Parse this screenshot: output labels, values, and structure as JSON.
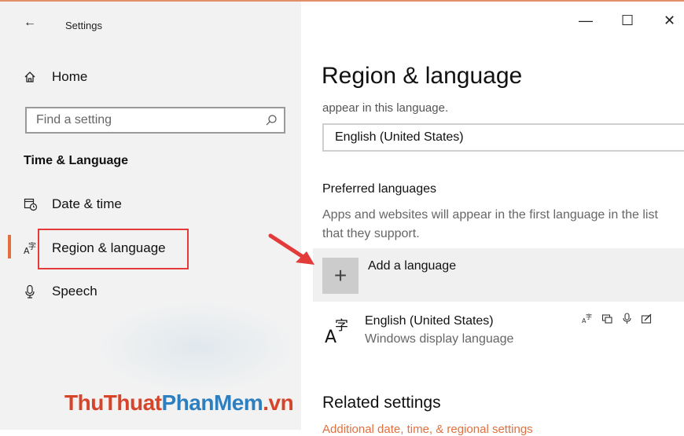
{
  "window": {
    "title": "Settings",
    "controls": {
      "minimize": "—",
      "maximize": "☐",
      "close": "✕"
    }
  },
  "sidebar": {
    "home_label": "Home",
    "search_placeholder": "Find a setting",
    "section_title": "Time & Language",
    "items": [
      {
        "label": "Date & time",
        "icon": "calendar-clock-icon"
      },
      {
        "label": "Region & language",
        "icon": "language-icon",
        "selected": true
      },
      {
        "label": "Speech",
        "icon": "microphone-icon"
      }
    ]
  },
  "main": {
    "title": "Region & language",
    "faded_text": "appear in this language.",
    "display_language_value": "English (United States)",
    "preferred": {
      "heading": "Preferred languages",
      "description": "Apps and websites will appear in the first language in the list that they support.",
      "add_label": "Add a language",
      "languages": [
        {
          "name": "English (United States)",
          "sub": "Windows display language"
        }
      ]
    },
    "related": {
      "heading": "Related settings",
      "link": "Additional date, time, & regional settings"
    }
  },
  "watermark": {
    "part1": "ThuThuat",
    "part2": "PhanMem",
    "part3": ".vn"
  },
  "colors": {
    "accent": "#e2703f",
    "highlight_box": "#e33a3a",
    "watermark_red": "#d6452a",
    "watermark_blue": "#2d7fc0"
  }
}
